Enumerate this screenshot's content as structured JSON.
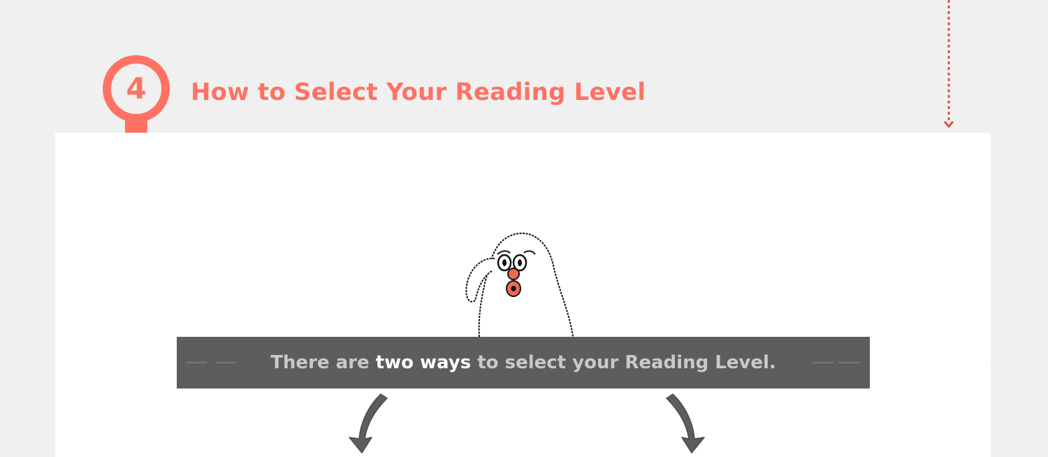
{
  "step": {
    "number": "4"
  },
  "section": {
    "title": "How to Select Your Reading Level"
  },
  "banner": {
    "text_before": "There are ",
    "text_highlight": "two ways",
    "text_after": " to select your Reading Level."
  },
  "colors": {
    "accent": "#ff7263",
    "page_background": "#f0f0f0",
    "card_background": "#ffffff",
    "banner_background": "#5d5d5d",
    "arrow": "#5d5d5d",
    "dotted_line": "#e0503f"
  }
}
